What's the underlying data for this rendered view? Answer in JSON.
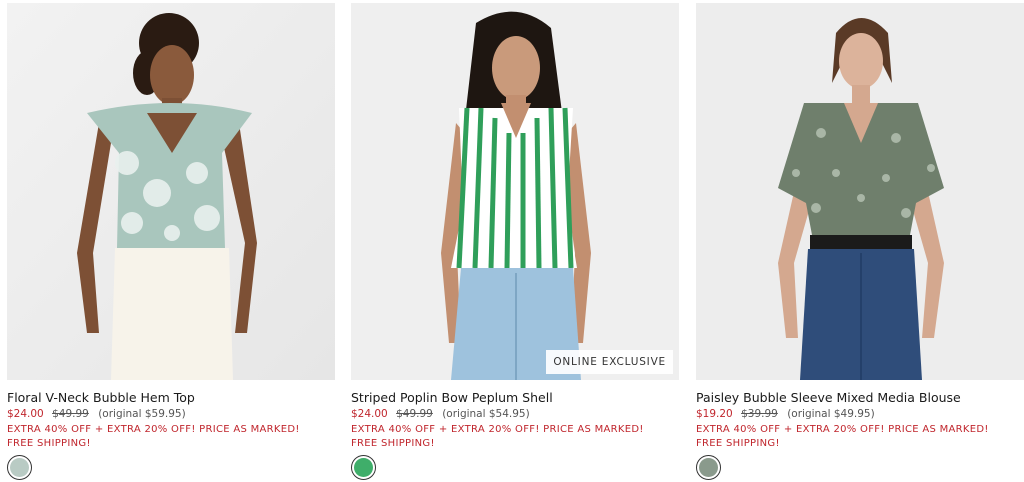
{
  "products": [
    {
      "name": "Floral V-Neck Bubble Hem Top",
      "sale_price": "$24.00",
      "was_price": "$49.99",
      "original_price": "(original $59.95)",
      "promo": "EXTRA 40% OFF + EXTRA 20% OFF! PRICE AS MARKED!",
      "shipping": "FREE SHIPPING!",
      "badge": "",
      "swatch_color": "#b9cbc4"
    },
    {
      "name": "Striped Poplin Bow Peplum Shell",
      "sale_price": "$24.00",
      "was_price": "$49.99",
      "original_price": "(original $54.95)",
      "promo": "EXTRA 40% OFF + EXTRA 20% OFF! PRICE AS MARKED!",
      "shipping": "FREE SHIPPING!",
      "badge": "ONLINE EXCLUSIVE",
      "swatch_color": "#3fae6a"
    },
    {
      "name": "Paisley Bubble Sleeve Mixed Media Blouse",
      "sale_price": "$19.20",
      "was_price": "$39.99",
      "original_price": "(original $49.95)",
      "promo": "EXTRA 40% OFF + EXTRA 20% OFF! PRICE AS MARKED!",
      "shipping": "FREE SHIPPING!",
      "badge": "",
      "swatch_color": "#8a9a8c"
    }
  ],
  "colors": {
    "sale": "#c0262d",
    "text": "#1a1a1a",
    "muted": "#555555"
  }
}
